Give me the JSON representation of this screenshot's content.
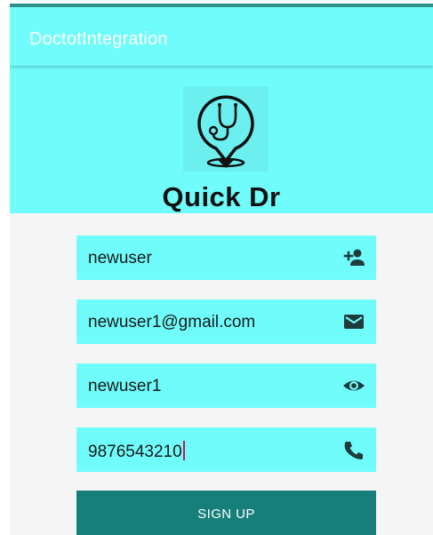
{
  "app_bar": {
    "title": "DoctotIntegration",
    "background": "#6ffcfb"
  },
  "header": {
    "brand": "Quick Dr",
    "logo_icon": "stethoscope-pin-icon"
  },
  "form": {
    "username": {
      "value": "newuser",
      "icon": "add-person-icon"
    },
    "email": {
      "value": "newuser1@gmail.com",
      "icon": "mail-icon"
    },
    "password": {
      "value": "newuser1",
      "icon": "eye-icon"
    },
    "phone": {
      "value": "9876543210",
      "icon": "phone-icon"
    }
  },
  "actions": {
    "signup_label": "SIGN UP",
    "signup_color": "#177f7a"
  },
  "colors": {
    "accent": "#6ffcfb",
    "icon": "#1f3b3b",
    "cursor": "#c2185b"
  }
}
